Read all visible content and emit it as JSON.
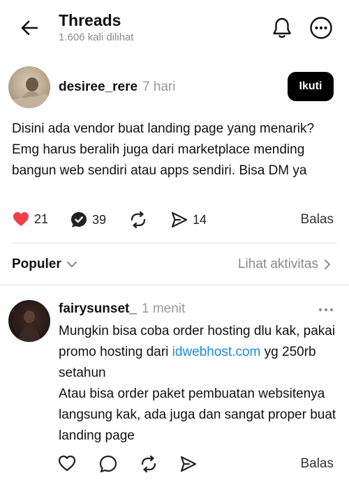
{
  "header": {
    "title": "Threads",
    "views": "1.606 kali dilihat"
  },
  "post": {
    "username": "desiree_rere",
    "time": "7 hari",
    "follow_label": "Ikuti",
    "text": "Disini ada vendor buat landing page yang menarik? Emg harus beralih juga dari marketplace mending bangun web sendiri atau apps sendiri. Bisa DM ya",
    "likes": "21",
    "replies": "39",
    "shares": "14",
    "reply_label": "Balas",
    "liked": true,
    "like_color": "#ef3e4a"
  },
  "sort": {
    "label": "Populer",
    "activity_label": "Lihat aktivitas"
  },
  "comment": {
    "username": "fairysunset_",
    "time": "1 menit",
    "text_before_link": "Mungkin bisa coba order hosting dlu kak, pakai promo hosting dari ",
    "link_text": "idwebhost.com",
    "text_after_link": " yg 250rb setahun",
    "text_line2": "Atau bisa order paket pembuatan websitenya langsung kak, ada juga dan sangat proper buat landing page",
    "reply_label": "Balas",
    "link_color": "#1a8cd8"
  }
}
